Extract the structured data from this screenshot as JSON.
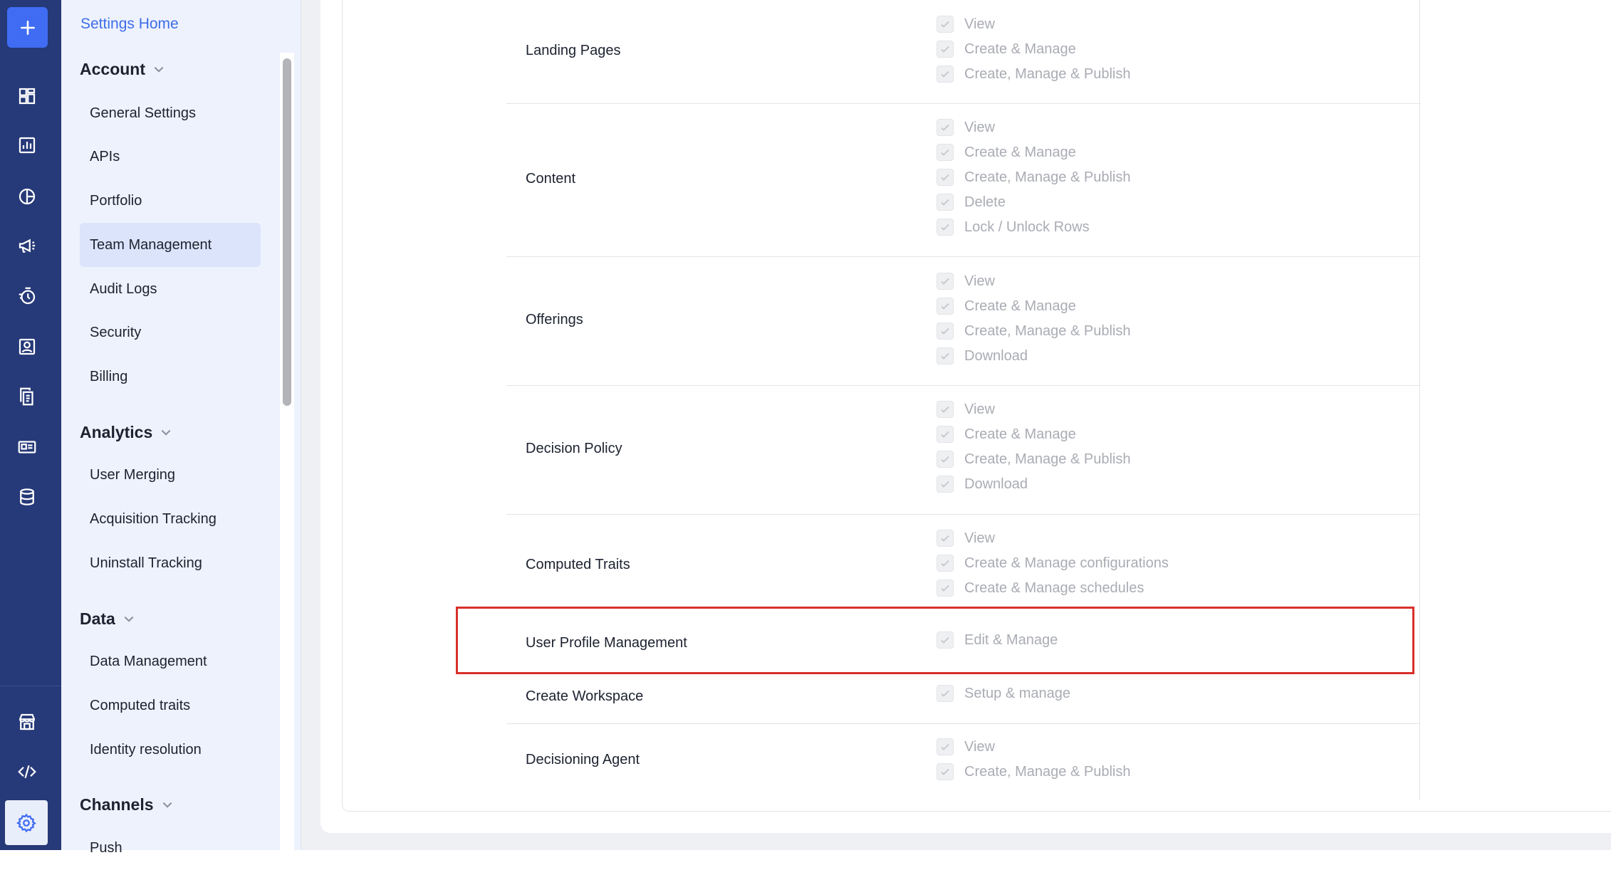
{
  "sidebar": {
    "home_link": "Settings Home",
    "sections": {
      "account": "Account",
      "analytics": "Analytics",
      "data": "Data",
      "channels": "Channels"
    },
    "items": {
      "general_settings": "General Settings",
      "apis": "APIs",
      "portfolio": "Portfolio",
      "team_management": "Team Management",
      "audit_logs": "Audit Logs",
      "security": "Security",
      "billing": "Billing",
      "user_merging": "User Merging",
      "acquisition_tracking": "Acquisition Tracking",
      "uninstall_tracking": "Uninstall Tracking",
      "data_management": "Data Management",
      "computed_traits": "Computed traits",
      "identity_resolution": "Identity resolution",
      "push": "Push"
    },
    "active_item": "Team Management"
  },
  "rail": {
    "icons": [
      "add-icon",
      "dashboard-icon",
      "analytics-icon",
      "segments-icon",
      "campaigns-icon",
      "flows-icon",
      "users-icon",
      "content-icon",
      "templates-icon",
      "data-icon",
      "store-icon",
      "developer-icon",
      "settings-icon"
    ]
  },
  "permissions": [
    {
      "label": "Landing Pages",
      "options": [
        "View",
        "Create & Manage",
        "Create, Manage & Publish"
      ]
    },
    {
      "label": "Content",
      "options": [
        "View",
        "Create & Manage",
        "Create, Manage & Publish",
        "Delete",
        "Lock / Unlock Rows"
      ]
    },
    {
      "label": "Offerings",
      "options": [
        "View",
        "Create & Manage",
        "Create, Manage & Publish",
        "Download"
      ]
    },
    {
      "label": "Decision Policy",
      "options": [
        "View",
        "Create & Manage",
        "Create, Manage & Publish",
        "Download"
      ]
    },
    {
      "label": "Computed Traits",
      "options": [
        "View",
        "Create & Manage configurations",
        "Create & Manage schedules"
      ]
    },
    {
      "label": "User Profile Management",
      "options": [
        "Edit & Manage"
      ]
    },
    {
      "label": "Create Workspace",
      "options": [
        "Setup & manage"
      ]
    },
    {
      "label": "Decisioning Agent",
      "options": [
        "View",
        "Create, Manage & Publish"
      ]
    }
  ],
  "colors": {
    "rail": "#263978",
    "accent": "#3f6cf3",
    "highlight": "#d9302a"
  }
}
